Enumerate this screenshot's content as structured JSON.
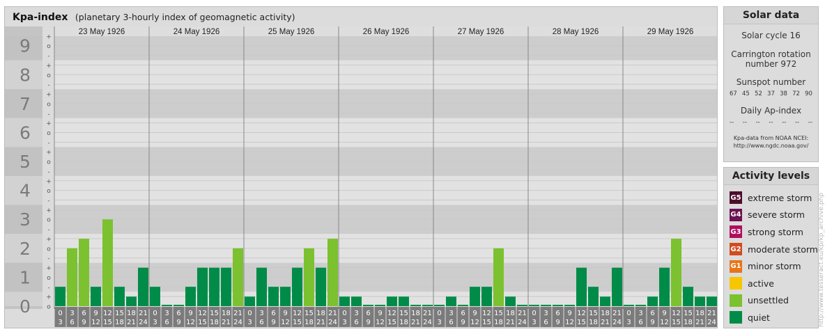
{
  "header": {
    "title": "Kpa-index",
    "subtitle": "(planetary 3-hourly index of geomagnetic activity)"
  },
  "chart_data": {
    "type": "bar",
    "dates": [
      "23 May 1926",
      "24 May 1926",
      "25 May 1926",
      "26 May 1926",
      "27 May 1926",
      "28 May 1926",
      "29 May 1926"
    ],
    "interval_start": [
      "0",
      "3",
      "6",
      "9",
      "12",
      "15",
      "18",
      "21"
    ],
    "interval_end": [
      "3",
      "6",
      "9",
      "12",
      "15",
      "18",
      "21",
      "24"
    ],
    "y_tick_labels": [
      "0",
      "1",
      "2",
      "3",
      "4",
      "5",
      "6",
      "7",
      "8",
      "9"
    ],
    "sub_tick_labels": [
      "o",
      "+",
      "-"
    ],
    "ylim": [
      0,
      9.33
    ],
    "values": [
      [
        0.67,
        2,
        2.33,
        0.67,
        3,
        0.67,
        0.33,
        1.33
      ],
      [
        0.67,
        0,
        0,
        0.67,
        1.33,
        1.33,
        1.33,
        2
      ],
      [
        0.33,
        1.33,
        0.67,
        0.67,
        1.33,
        2,
        1.33,
        2.33
      ],
      [
        0.33,
        0.33,
        0,
        0,
        0.33,
        0.33,
        0,
        0
      ],
      [
        0,
        0.33,
        0,
        0.67,
        0.67,
        2,
        0.33,
        0
      ],
      [
        0,
        0,
        0,
        0,
        1.33,
        0.67,
        0.33,
        1.33
      ],
      [
        0,
        0,
        0.33,
        1.33,
        2.33,
        0.67,
        0.33,
        0.33
      ]
    ],
    "colors": {
      "quiet": "#008c48",
      "unsettled": "#7cc12f",
      "active": "#f7c600",
      "minor": "#e7761a",
      "moderate": "#d24b1e",
      "strong": "#b00e5e",
      "severe": "#6e1250",
      "extreme": "#4c0d2c"
    }
  },
  "solar": {
    "title": "Solar data",
    "cycle": "Solar cycle 16",
    "carrington_line1": "Carrington rotation",
    "carrington_line2": "number 972",
    "sunspot_title": "Sunspot number",
    "sunspot_values": [
      "67",
      "45",
      "52",
      "37",
      "38",
      "72",
      "90"
    ],
    "ap_title": "Daily Ap-index",
    "ap_values": [
      "--",
      "--",
      "--",
      "--",
      "--",
      "--",
      "--"
    ],
    "credit_line1": "Kpa-data from NOAA NCEI:",
    "credit_line2": "http://www.ngdc.noaa.gov/"
  },
  "legend": {
    "title": "Activity levels",
    "items": [
      {
        "badge": "G5",
        "label": "extreme storm",
        "color": "#4c0d2c"
      },
      {
        "badge": "G4",
        "label": "severe storm",
        "color": "#6e1250"
      },
      {
        "badge": "G3",
        "label": "strong storm",
        "color": "#b00e5e"
      },
      {
        "badge": "G2",
        "label": "moderate storm",
        "color": "#d24b1e"
      },
      {
        "badge": "G1",
        "label": "minor storm",
        "color": "#e7761a"
      },
      {
        "badge": "",
        "label": "active",
        "color": "#f7c600"
      },
      {
        "badge": "",
        "label": "unsettled",
        "color": "#7cc12f"
      },
      {
        "badge": "",
        "label": "quiet",
        "color": "#008c48"
      }
    ]
  },
  "watermark": "http://www.tesseract.eu/kp/kp_archive.php"
}
